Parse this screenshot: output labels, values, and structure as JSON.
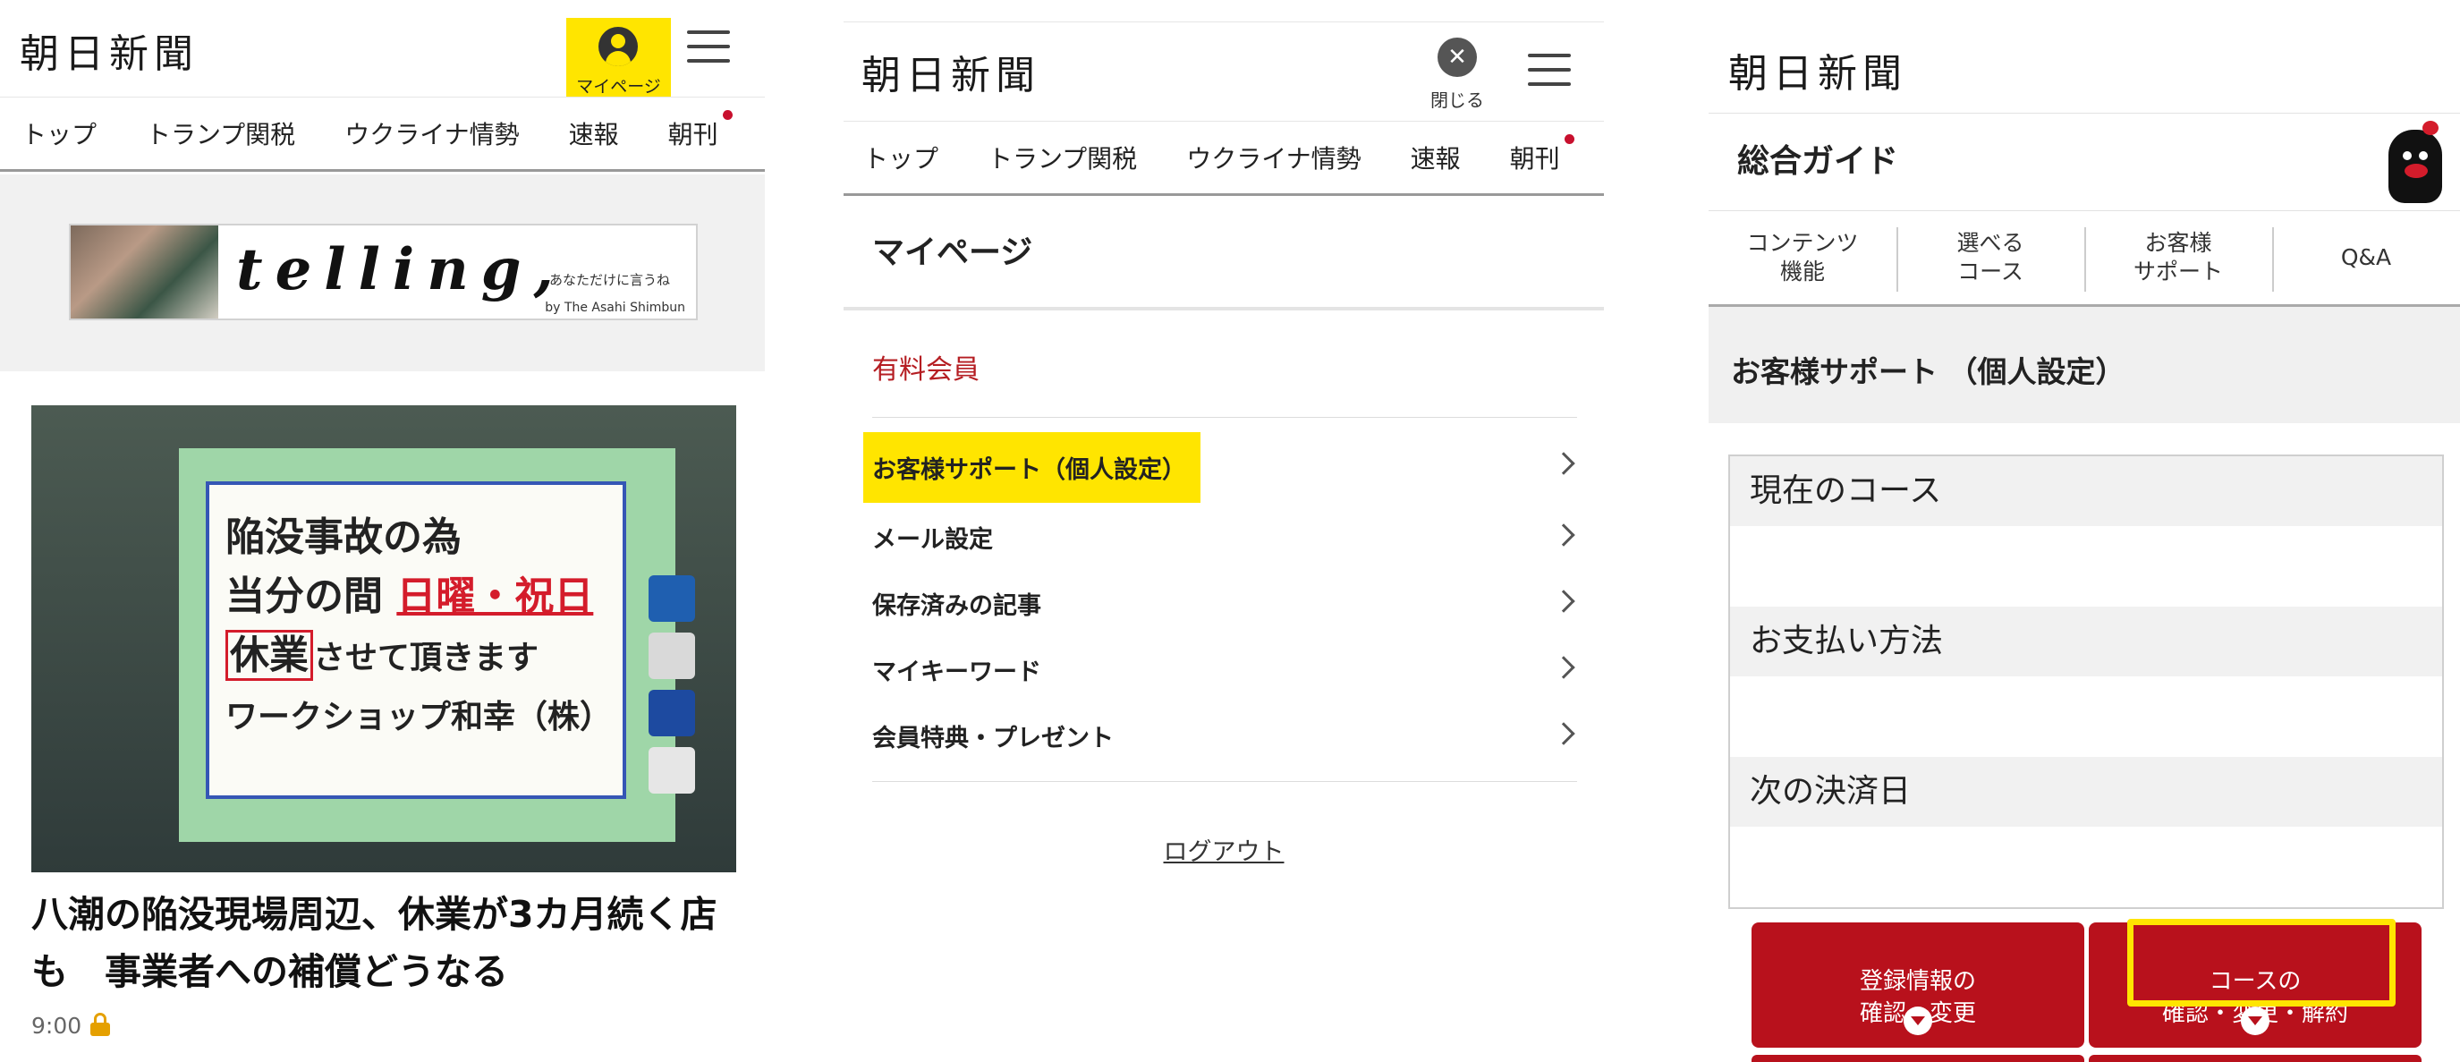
{
  "site": {
    "logo": "朝日新聞"
  },
  "panel1": {
    "mypage_label": "マイページ",
    "tabs": [
      {
        "label": "トップ"
      },
      {
        "label": "トランプ関税"
      },
      {
        "label": "ウクライナ情勢"
      },
      {
        "label": "速報"
      },
      {
        "label": "朝刊",
        "has_dot": true
      }
    ],
    "ad": {
      "logo": "telling,",
      "tagline": "あなただけに言うね",
      "byline": "by The Asahi Shimbun"
    },
    "photo_sign": {
      "line1": "陥没事故の為",
      "line2a": "当分の間",
      "line2b": "日曜・祝日",
      "line3a": "休業",
      "line3b": "させて頂きます",
      "line4": "ワークショップ和幸（株）"
    },
    "article": {
      "title": "八潮の陥没現場周辺、休業が3カ月続く店も　事業者への補償どうなる",
      "time": "9:00"
    }
  },
  "panel2": {
    "close_label": "閉じる",
    "tabs": [
      {
        "label": "トップ"
      },
      {
        "label": "トランプ関税"
      },
      {
        "label": "ウクライナ情勢"
      },
      {
        "label": "速報"
      },
      {
        "label": "朝刊",
        "has_dot": true
      }
    ],
    "menu_title": "マイページ",
    "paid_member_label": "有料会員",
    "items": [
      {
        "label": "お客様サポート（個人設定）",
        "highlighted": true
      },
      {
        "label": "メール設定"
      },
      {
        "label": "保存済みの記事"
      },
      {
        "label": "マイキーワード"
      },
      {
        "label": "会員特典・プレゼント"
      }
    ],
    "logout": "ログアウト"
  },
  "panel3": {
    "guide_title": "総合ガイド",
    "tabs": [
      {
        "label": "コンテンツ\n機能"
      },
      {
        "label": "選べる\nコース"
      },
      {
        "label": "お客様\nサポート"
      },
      {
        "label": "Q&A"
      }
    ],
    "section_title": "お客様サポート （個人設定）",
    "info": [
      {
        "label": "現在のコース",
        "value": ""
      },
      {
        "label": "お支払い方法",
        "value": ""
      },
      {
        "label": "次の決済日",
        "value": ""
      }
    ],
    "buttons": [
      {
        "label": "登録情報の\n確認・変更"
      },
      {
        "label": "コースの\n確認・変更・解約",
        "highlighted": true
      }
    ]
  },
  "colors": {
    "brand_red": "#b8111c",
    "highlight_yellow": "#ffe500",
    "paid_label_red": "#b51d22"
  }
}
